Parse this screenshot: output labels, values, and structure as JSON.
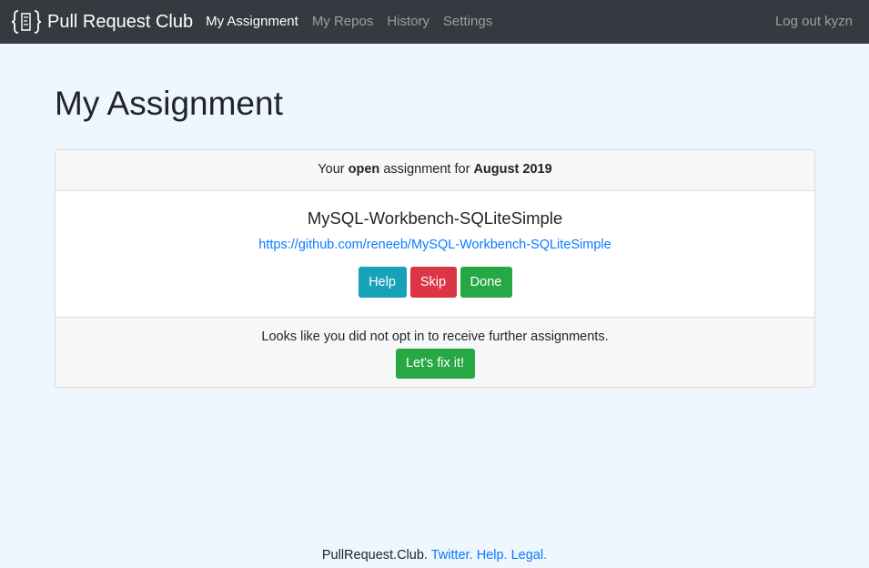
{
  "navbar": {
    "brand": "Pull Request Club",
    "links": [
      {
        "label": "My Assignment",
        "active": true
      },
      {
        "label": "My Repos",
        "active": false
      },
      {
        "label": "History",
        "active": false
      },
      {
        "label": "Settings",
        "active": false
      }
    ],
    "logout": "Log out kyzn"
  },
  "page": {
    "title": "My Assignment"
  },
  "assignment": {
    "header_prefix": "Your",
    "status": "open",
    "header_middle": "assignment for",
    "period": "August 2019",
    "repo_name": "MySQL-Workbench-SQLiteSimple",
    "repo_url": "https://github.com/reneeb/MySQL-Workbench-SQLiteSimple",
    "buttons": {
      "help": "Help",
      "skip": "Skip",
      "done": "Done"
    },
    "optin_message": "Looks like you did not opt in to receive further assignments.",
    "fix_button": "Let's fix it!"
  },
  "footer": {
    "site": "PullRequest.Club.",
    "twitter": "Twitter.",
    "help": "Help.",
    "legal": "Legal."
  },
  "colors": {
    "navbar_bg": "#343a40",
    "page_bg": "#eef6fe",
    "link": "#0a7bff",
    "info": "#17a2b8",
    "danger": "#dc3545",
    "success": "#28a745"
  },
  "icons": {
    "brand_logo": "curly-braces-code-icon"
  }
}
